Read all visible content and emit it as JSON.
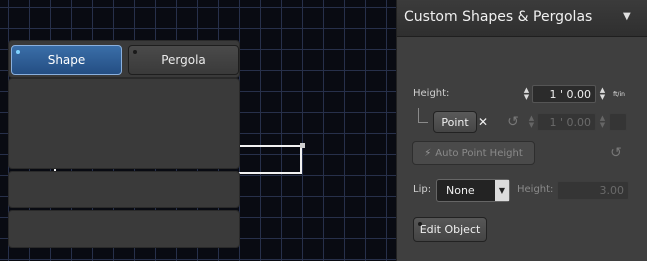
{
  "panel": {
    "title": "Custom Shapes & Pergolas",
    "menu_glyph": "▼",
    "tabs": [
      {
        "label": "Shape",
        "active": true
      },
      {
        "label": "Pergola",
        "active": false
      }
    ]
  },
  "height": {
    "label": "Height:",
    "value": "1 ' 0.00",
    "unit_label": "ft/in"
  },
  "point": {
    "button_label": "Point",
    "clear_glyph": "✕",
    "reset_glyph": "↺",
    "value": "1 ' 0.00"
  },
  "auto_point_height": {
    "label": "Auto Point Height",
    "icon_glyph": "⚡",
    "reset_glyph": "↺"
  },
  "lip": {
    "label": "Lip:",
    "selected": "None",
    "height_label": "Height:",
    "height_value": "3.00"
  },
  "edit_object": {
    "label": "Edit Object"
  },
  "spinner": {
    "up": "▲",
    "down": "▼"
  },
  "colors": {
    "canvas_bg": "#090b12",
    "grid": "#27304a",
    "panel_bg": "#3f3f3f",
    "active_tab": "#2f5f97",
    "active_led": "#7fd3ff"
  }
}
